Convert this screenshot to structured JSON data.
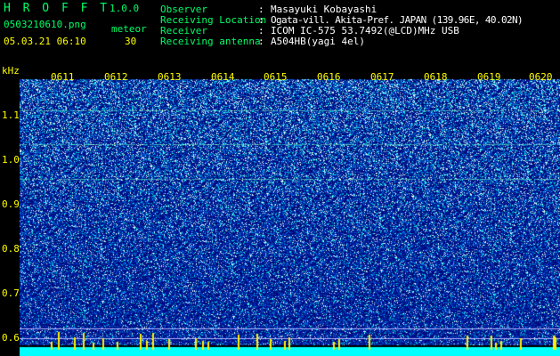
{
  "app": {
    "title": "H R O F F T",
    "version": "1.0.0",
    "filename": "0503210610.png",
    "datetime": "05.03.21 06:10",
    "count_label": "meteor",
    "count_value": "30"
  },
  "info": [
    {
      "label": "Observer",
      "sep": ":",
      "value": "Masayuki Kobayashi"
    },
    {
      "label": "Receiving Location",
      "sep": ":",
      "value": "Ogata-vill. Akita-Pref. JAPAN (139.96E, 40.02N)"
    },
    {
      "label": "Receiver",
      "sep": ":",
      "value": "ICOM IC-575 53.7492(@LCD)MHz USB"
    },
    {
      "label": "Receiving antenna",
      "sep": ":",
      "value": "A504HB(yagi 4el)"
    }
  ],
  "axis": {
    "unit": "kHz",
    "y_ticks": [
      "1.1",
      "1.0",
      "0.9",
      "0.8",
      "0.7",
      "0.6"
    ],
    "x_ticks": [
      "0611",
      "0612",
      "0613",
      "0614",
      "0615",
      "0616",
      "0617",
      "0618",
      "0619",
      "0620"
    ]
  },
  "colors": {
    "background": "#000000",
    "label_green": "#00ff66",
    "value_yellow": "#ffff00",
    "noise_floor": "#001a99",
    "signal_cyan": "#00e5ff",
    "baseline_cyan": "#00ffff",
    "meteor_yellow": "#ffee00"
  }
}
